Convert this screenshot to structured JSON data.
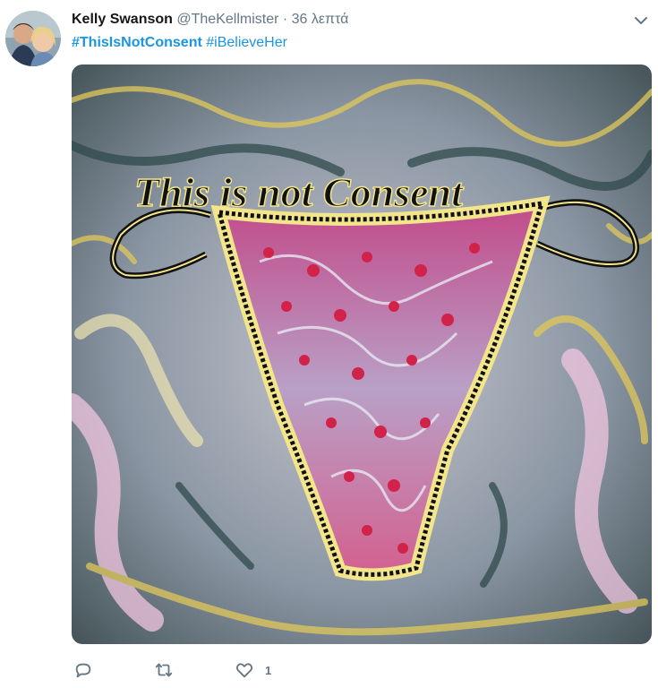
{
  "author": {
    "name": "Kelly Swanson",
    "handle": "@TheKellmister",
    "separator": "·",
    "time": "36 λεπτά"
  },
  "tweet": {
    "hashtags": [
      "#ThisIsNotConsent",
      "#iBelieveHer"
    ]
  },
  "media": {
    "caption_text": "This is not Consent"
  },
  "actions": {
    "reply_icon": "reply-icon",
    "retweet_icon": "retweet-icon",
    "like_icon": "like-icon",
    "like_count": "1"
  },
  "colors": {
    "link": "#1b95e0",
    "text": "#14171a",
    "secondary": "#657786"
  }
}
